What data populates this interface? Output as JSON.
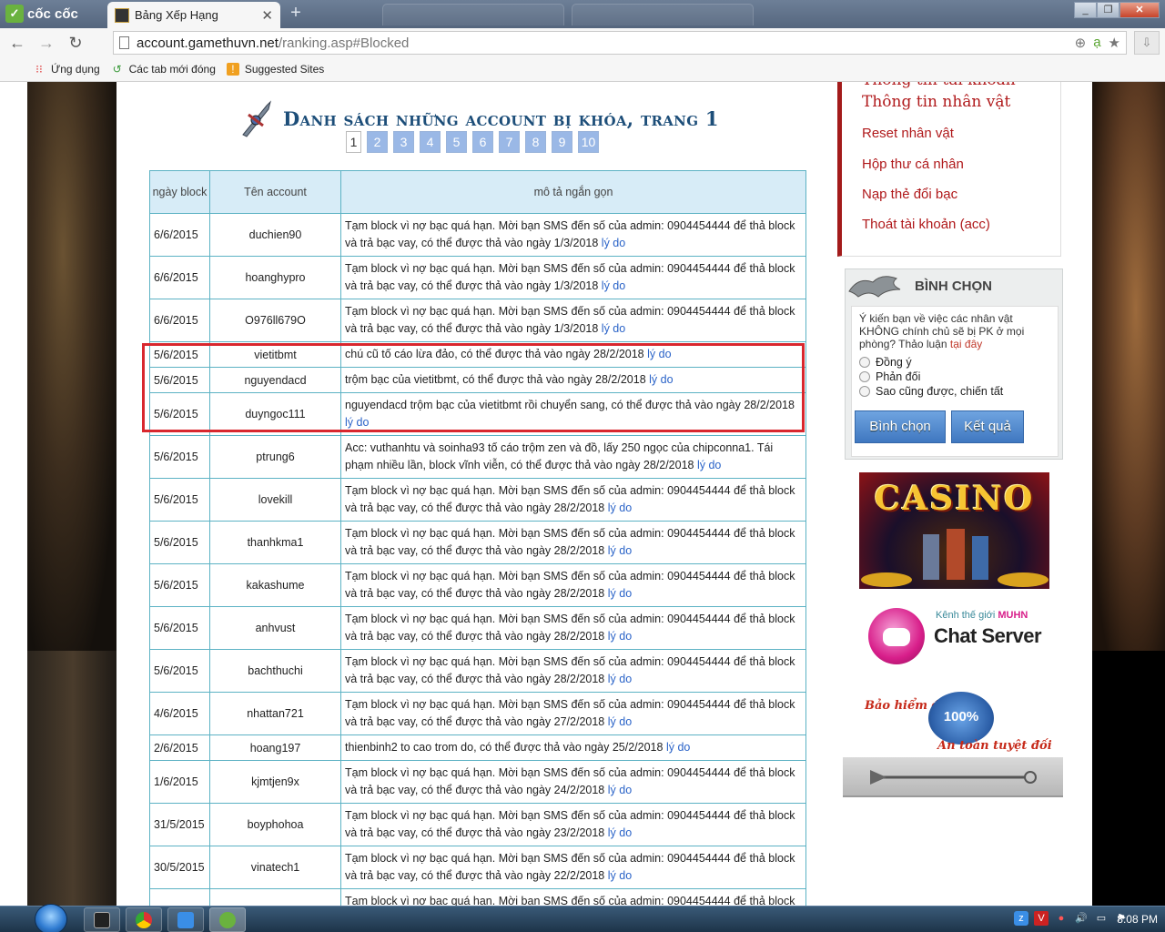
{
  "browser": {
    "brand": "cốc cốc",
    "tab_title": "Bảng Xếp Hạng",
    "url_domain": "account.gamethuvn.net",
    "url_path": "/ranking.asp#Blocked",
    "bookmarks": [
      "Ứng dụng",
      "Các tab mới đóng",
      "Suggested Sites"
    ]
  },
  "page": {
    "title": "Danh sách những account bị khóa, trang 1",
    "pages": [
      "1",
      "2",
      "3",
      "4",
      "5",
      "6",
      "7",
      "8",
      "9",
      "10"
    ],
    "current_page": "1",
    "table": {
      "headers": [
        "ngày block",
        "Tên account",
        "mô tả ngắn gọn"
      ],
      "reason_link": "lý do",
      "rows": [
        {
          "date": "6/6/2015",
          "account": "duchien90",
          "desc": "Tạm block vì nợ bạc quá hạn. Mời bạn SMS đến số của admin: 0904454444 để thả block và trả bạc vay, có thể được thả vào ngày 1/3/2018"
        },
        {
          "date": "6/6/2015",
          "account": "hoanghypro",
          "desc": "Tạm block vì nợ bạc quá hạn. Mời bạn SMS đến số của admin: 0904454444 để thả block và trả bạc vay, có thể được thả vào ngày 1/3/2018"
        },
        {
          "date": "6/6/2015",
          "account": "O976ll679O",
          "desc": "Tạm block vì nợ bạc quá hạn. Mời bạn SMS đến số của admin: 0904454444 để thả block và trả bạc vay, có thể được thả vào ngày 1/3/2018"
        },
        {
          "date": "5/6/2015",
          "account": "vietitbmt",
          "desc": "chú cũ tố cáo lừa đảo, có thể được thả vào ngày 28/2/2018"
        },
        {
          "date": "5/6/2015",
          "account": "nguyendacd",
          "desc": "trộm bạc của vietitbmt, có thể được thả vào ngày 28/2/2018"
        },
        {
          "date": "5/6/2015",
          "account": "duyngoc111",
          "desc": "nguyendacd trộm bạc của vietitbmt rồi chuyển sang, có thể được thả vào ngày 28/2/2018"
        },
        {
          "date": "5/6/2015",
          "account": "ptrung6",
          "desc": "Acc: vuthanhtu và soinha93 tố cáo trộm zen và đồ, lấy 250 ngọc của chipconna1. Tái phạm nhiều lần, block vĩnh viễn, có thể được thả vào ngày 28/2/2018"
        },
        {
          "date": "5/6/2015",
          "account": "lovekill",
          "desc": "Tạm block vì nợ bạc quá hạn. Mời bạn SMS đến số của admin: 0904454444 để thả block và trả bạc vay, có thể được thả vào ngày 28/2/2018"
        },
        {
          "date": "5/6/2015",
          "account": "thanhkma1",
          "desc": "Tạm block vì nợ bạc quá hạn. Mời bạn SMS đến số của admin: 0904454444 để thả block và trả bạc vay, có thể được thả vào ngày 28/2/2018"
        },
        {
          "date": "5/6/2015",
          "account": "kakashume",
          "desc": "Tạm block vì nợ bạc quá hạn. Mời bạn SMS đến số của admin: 0904454444 để thả block và trả bạc vay, có thể được thả vào ngày 28/2/2018"
        },
        {
          "date": "5/6/2015",
          "account": "anhvust",
          "desc": "Tạm block vì nợ bạc quá hạn. Mời bạn SMS đến số của admin: 0904454444 để thả block và trả bạc vay, có thể được thả vào ngày 28/2/2018"
        },
        {
          "date": "5/6/2015",
          "account": "bachthuchi",
          "desc": "Tạm block vì nợ bạc quá hạn. Mời bạn SMS đến số của admin: 0904454444 để thả block và trả bạc vay, có thể được thả vào ngày 28/2/2018"
        },
        {
          "date": "4/6/2015",
          "account": "nhattan721",
          "desc": "Tạm block vì nợ bạc quá hạn. Mời bạn SMS đến số của admin: 0904454444 để thả block và trả bạc vay, có thể được thả vào ngày 27/2/2018"
        },
        {
          "date": "2/6/2015",
          "account": "hoang197",
          "desc": "thienbinh2 to cao trom do, có thể được thả vào ngày 25/2/2018"
        },
        {
          "date": "1/6/2015",
          "account": "kjmtjen9x",
          "desc": "Tạm block vì nợ bạc quá hạn. Mời bạn SMS đến số của admin: 0904454444 để thả block và trả bạc vay, có thể được thả vào ngày 24/2/2018"
        },
        {
          "date": "31/5/2015",
          "account": "boyphohoa",
          "desc": "Tạm block vì nợ bạc quá hạn. Mời bạn SMS đến số của admin: 0904454444 để thả block và trả bạc vay, có thể được thả vào ngày 23/2/2018"
        },
        {
          "date": "30/5/2015",
          "account": "vinatech1",
          "desc": "Tạm block vì nợ bạc quá hạn. Mời bạn SMS đến số của admin: 0904454444 để thả block và trả bạc vay, có thể được thả vào ngày 22/2/2018"
        },
        {
          "date": "",
          "account": "",
          "desc": "Tạm block vì nợ bạc quá hạn. Mời bạn SMS đến số của admin: 0904454444 để thả block và trả bạc vay"
        }
      ]
    }
  },
  "sidebar": {
    "menu": [
      "Thông tin tài khoản",
      "Thông tin nhân vật",
      "Reset nhân vật",
      "Hộp thư cá nhân",
      "Nạp thẻ đổi bạc",
      "Thoát tài khoản (acc)"
    ],
    "vote": {
      "title": "BÌNH CHỌN",
      "question": "Ý kiến bạn về việc các nhân vật KHÔNG chính chủ sẽ bị PK ở mọi phòng? Thảo luận",
      "discuss_link": "tại đây",
      "options": [
        "Đồng ý",
        "Phản đối",
        "Sao cũng được, chiến tất"
      ],
      "vote_button": "Bình chọn",
      "result_button": "Kết quả"
    },
    "banners": {
      "casino": "CASINO",
      "chat_subtitle_prefix": "Kênh thế giới",
      "chat_subtitle_brand": "MUHN",
      "chat_title": "Chat Server",
      "insurance_top": "Bảo hiểm đồ",
      "insurance_seal": "100%",
      "insurance_bottom": "An toàn tuyệt đối"
    }
  },
  "taskbar": {
    "clock": "8:08 PM"
  }
}
